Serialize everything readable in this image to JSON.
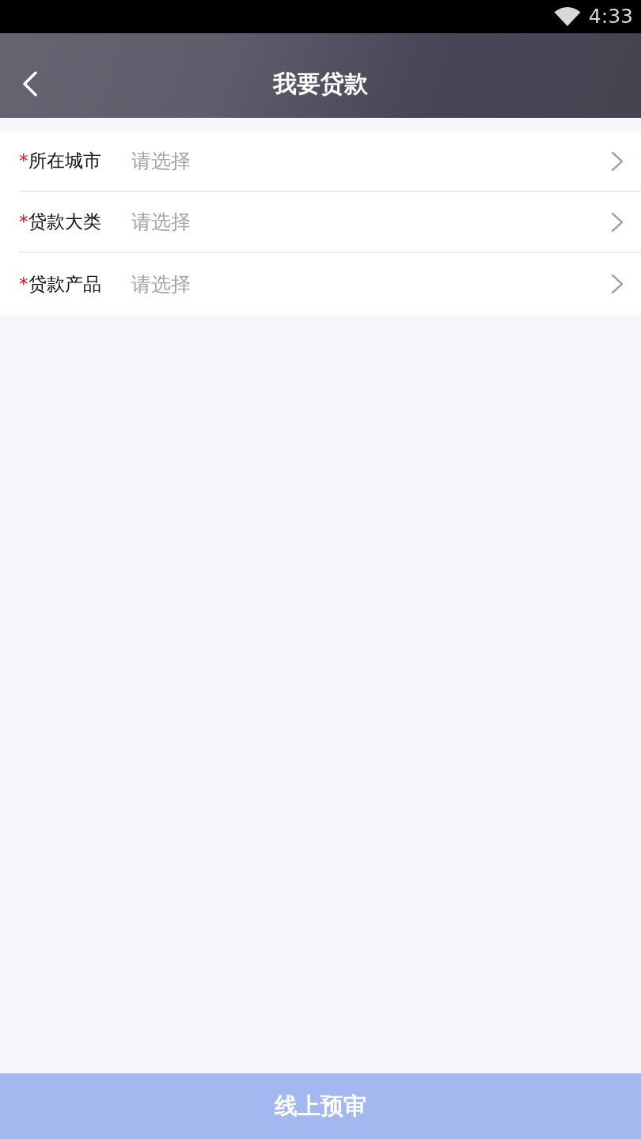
{
  "status_bar": {
    "time": "4:33"
  },
  "header": {
    "title": "我要贷款"
  },
  "form": {
    "fields": [
      {
        "required_mark": "*",
        "label": "所在城市",
        "placeholder": "请选择"
      },
      {
        "required_mark": "*",
        "label": "贷款大类",
        "placeholder": "请选择"
      },
      {
        "required_mark": "*",
        "label": "贷款产品",
        "placeholder": "请选择"
      }
    ]
  },
  "submit_button": {
    "label": "线上预审"
  }
}
